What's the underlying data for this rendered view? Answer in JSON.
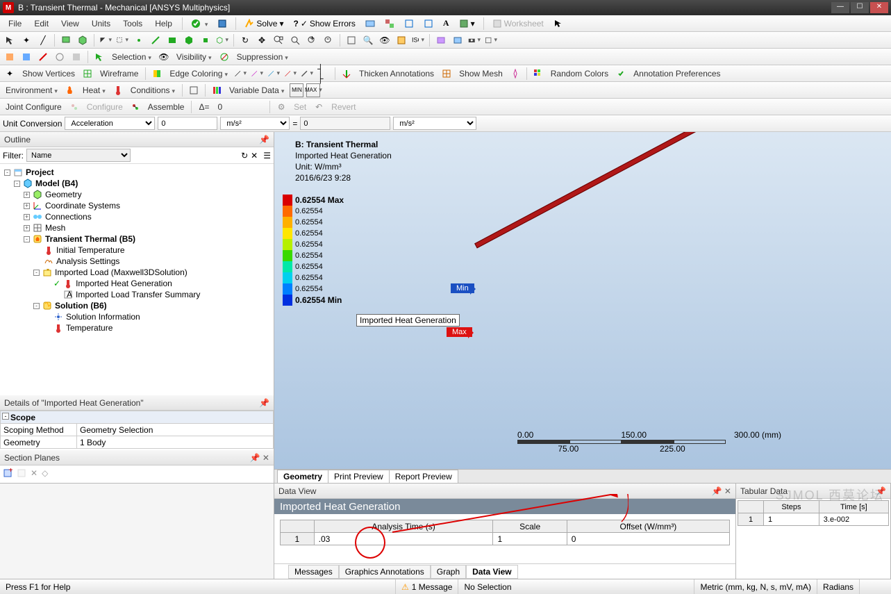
{
  "window": {
    "title": "B : Transient Thermal - Mechanical [ANSYS Multiphysics]"
  },
  "menus": [
    "File",
    "Edit",
    "View",
    "Units",
    "Tools",
    "Help"
  ],
  "menu_buttons": {
    "solve": "Solve",
    "show_errors": "Show Errors",
    "worksheet": "Worksheet"
  },
  "toolbar2": {
    "selection": "Selection",
    "visibility": "Visibility",
    "suppression": "Suppression"
  },
  "toolbar3": {
    "show_vertices": "Show Vertices",
    "wireframe": "Wireframe",
    "edge_coloring": "Edge Coloring",
    "thicken": "Thicken Annotations",
    "show_mesh": "Show Mesh",
    "random_colors": "Random Colors",
    "annot_prefs": "Annotation Preferences"
  },
  "toolbar4": {
    "environment": "Environment",
    "heat": "Heat",
    "conditions": "Conditions",
    "variable_data": "Variable Data"
  },
  "toolbar5": {
    "joint": "Joint Configure",
    "configure": "Configure",
    "assemble": "Assemble",
    "delta": "Δ=",
    "delta_val": "0",
    "set": "Set",
    "revert": "Revert"
  },
  "unit_conv": {
    "label": "Unit Conversion",
    "quantity": "Acceleration",
    "val1": "0",
    "unit1": "m/s²",
    "eq": "=",
    "val2": "0",
    "unit2": "m/s²"
  },
  "outline": {
    "title": "Outline",
    "filter_label": "Filter:",
    "filter_by": "Name",
    "nodes": {
      "project": "Project",
      "model": "Model (B4)",
      "geometry": "Geometry",
      "coord": "Coordinate Systems",
      "connections": "Connections",
      "mesh": "Mesh",
      "transient": "Transient Thermal (B5)",
      "init_temp": "Initial Temperature",
      "analysis_settings": "Analysis Settings",
      "imported_load": "Imported Load (Maxwell3DSolution)",
      "imported_heat": "Imported Heat Generation",
      "transfer_summary": "Imported Load Transfer Summary",
      "solution": "Solution (B6)",
      "solution_info": "Solution Information",
      "temperature": "Temperature"
    }
  },
  "viewport": {
    "title": "B: Transient Thermal",
    "subtitle": "Imported Heat Generation",
    "unit": "Unit: W/mm³",
    "timestamp": "2016/6/23 9:28",
    "box_label": "Imported Heat Generation",
    "min_tag": "Min",
    "max_tag": "Max",
    "legend": [
      {
        "c": "#d90000",
        "t": "0.62554 Max"
      },
      {
        "c": "#ff6a00",
        "t": "0.62554"
      },
      {
        "c": "#ffb000",
        "t": "0.62554"
      },
      {
        "c": "#ffe600",
        "t": "0.62554"
      },
      {
        "c": "#b6f000",
        "t": "0.62554"
      },
      {
        "c": "#39d900",
        "t": "0.62554"
      },
      {
        "c": "#00e8a8",
        "t": "0.62554"
      },
      {
        "c": "#00d0ee",
        "t": "0.62554"
      },
      {
        "c": "#0080ff",
        "t": "0.62554"
      },
      {
        "c": "#0030e0",
        "t": "0.62554 Min"
      }
    ],
    "ruler_top": [
      "0.00",
      "150.00",
      "300.00 (mm)"
    ],
    "ruler_bottom": [
      "75.00",
      "225.00"
    ],
    "tabs": [
      "Geometry",
      "Print Preview",
      "Report Preview"
    ]
  },
  "details": {
    "title": "Details of \"Imported Heat Generation\"",
    "cat": "Scope",
    "rows": [
      [
        "Scoping Method",
        "Geometry Selection"
      ],
      [
        "Geometry",
        "1 Body"
      ]
    ]
  },
  "section_planes": {
    "title": "Section Planes"
  },
  "data_view": {
    "pane_title": "Data View",
    "title": "Imported Heat Generation",
    "headers": [
      "",
      "Analysis Time (s)",
      "Scale",
      "Offset (W/mm³)"
    ],
    "row": [
      "1",
      ".03",
      "1",
      "0"
    ],
    "tabs": [
      "Messages",
      "Graphics Annotations",
      "Graph",
      "Data View"
    ]
  },
  "tabular": {
    "title": "Tabular Data",
    "headers": [
      "",
      "Steps",
      "Time [s]"
    ],
    "row": [
      "1",
      "1",
      "3.e-002"
    ]
  },
  "status": {
    "help": "Press F1 for Help",
    "messages": "1 Message",
    "selection": "No Selection",
    "units": "Metric (mm, kg, N, s, mV, mA)",
    "angle": "Radians"
  },
  "watermark": "SJMOL 西莫论坛"
}
